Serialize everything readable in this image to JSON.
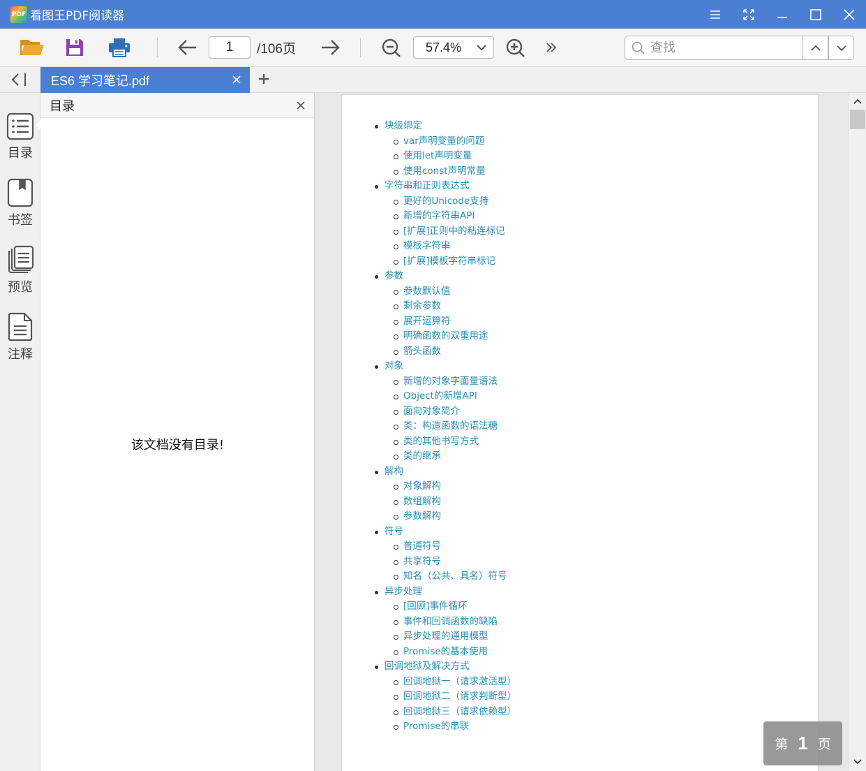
{
  "app": {
    "logo_text": "PDF",
    "title": "看图王PDF阅读器"
  },
  "toolbar": {
    "page_value": "1",
    "page_total": "/106页",
    "zoom_value": "57.4%",
    "search_placeholder": "查找"
  },
  "tabs": [
    {
      "label": "ES6 学习笔记.pdf"
    }
  ],
  "sidebar": {
    "items": [
      {
        "label": "目录",
        "icon": "toc-list-icon"
      },
      {
        "label": "书签",
        "icon": "bookmark-icon"
      },
      {
        "label": "预览",
        "icon": "preview-icon"
      },
      {
        "label": "注释",
        "icon": "annotation-icon"
      }
    ]
  },
  "toc_panel": {
    "title": "目录",
    "empty_message": "该文档没有目录!"
  },
  "document": {
    "toc": [
      {
        "level": 1,
        "text": "块级绑定"
      },
      {
        "level": 2,
        "text": "var声明变量的问题"
      },
      {
        "level": 2,
        "text": "使用let声明变量"
      },
      {
        "level": 2,
        "text": "使用const声明常量"
      },
      {
        "level": 1,
        "text": "字符串和正则表达式"
      },
      {
        "level": 2,
        "text": "更好的Unicode支持"
      },
      {
        "level": 2,
        "text": "新增的字符串API"
      },
      {
        "level": 2,
        "text": "[扩展]正则中的粘连标记"
      },
      {
        "level": 2,
        "text": "模板字符串"
      },
      {
        "level": 2,
        "text": "[扩展]模板字符串标记"
      },
      {
        "level": 1,
        "text": "参数"
      },
      {
        "level": 2,
        "text": "参数默认值"
      },
      {
        "level": 2,
        "text": "剩余参数"
      },
      {
        "level": 2,
        "text": "展开运算符"
      },
      {
        "level": 2,
        "text": "明确函数的双重用途"
      },
      {
        "level": 2,
        "text": "箭头函数"
      },
      {
        "level": 1,
        "text": "对象"
      },
      {
        "level": 2,
        "text": "新增的对象字面量语法"
      },
      {
        "level": 2,
        "text": "Object的新增API"
      },
      {
        "level": 2,
        "text": "面向对象简介"
      },
      {
        "level": 2,
        "text": "类：构造函数的语法糖"
      },
      {
        "level": 2,
        "text": "类的其他书写方式"
      },
      {
        "level": 2,
        "text": "类的继承"
      },
      {
        "level": 1,
        "text": "解构"
      },
      {
        "level": 2,
        "text": "对象解构"
      },
      {
        "level": 2,
        "text": "数组解构"
      },
      {
        "level": 2,
        "text": "参数解构"
      },
      {
        "level": 1,
        "text": "符号"
      },
      {
        "level": 2,
        "text": "普通符号"
      },
      {
        "level": 2,
        "text": "共享符号"
      },
      {
        "level": 2,
        "text": "知名（公共、具名）符号"
      },
      {
        "level": 1,
        "text": "异步处理"
      },
      {
        "level": 2,
        "text": "[回顾]事件循环"
      },
      {
        "level": 2,
        "text": "事件和回调函数的缺陷"
      },
      {
        "level": 2,
        "text": "异步处理的通用模型"
      },
      {
        "level": 2,
        "text": "Promise的基本使用"
      },
      {
        "level": 1,
        "text": "回调地狱及解决方式"
      },
      {
        "level": 2,
        "text": "回调地狱一（请求激活型）"
      },
      {
        "level": 2,
        "text": "回调地狱二（请求判断型）"
      },
      {
        "level": 2,
        "text": "回调地狱三（请求依赖型）"
      },
      {
        "level": 2,
        "text": "Promise的串联"
      }
    ]
  },
  "page_indicator": {
    "prefix": "第",
    "number": "1",
    "suffix": "页"
  },
  "colors": {
    "accent": "#4a7fd4",
    "link": "#2a8fb3",
    "folder": "#f0a92e",
    "save": "#8e44ad",
    "print": "#2f6fb5"
  }
}
